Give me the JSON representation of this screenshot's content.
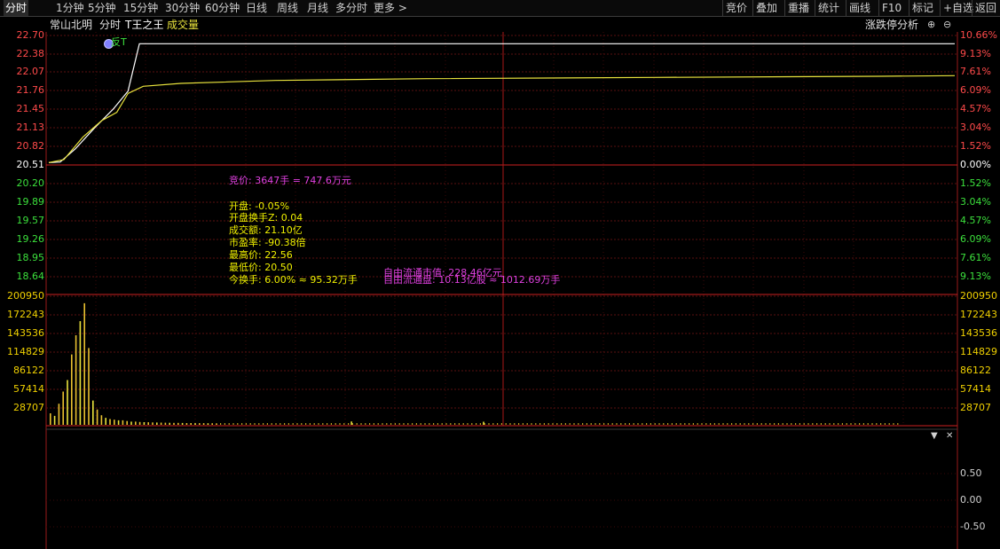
{
  "toolbar": {
    "left_tabs": [
      "分时",
      "1分钟",
      "5分钟",
      "15分钟",
      "30分钟",
      "60分钟",
      "日线",
      "周线",
      "月线",
      "多分时",
      "更多 >"
    ],
    "active_tab": 0,
    "right_buttons": [
      "竞价",
      "叠加",
      "重播",
      "统计",
      "画线",
      "F10",
      "标记",
      "+自选",
      "返回"
    ]
  },
  "header": {
    "stock_name": "常山北明",
    "mode": "分时",
    "indicator": "T王之王",
    "volume_label": "成交量",
    "analysis_button": "涨跌停分析"
  },
  "price_axis": {
    "left": [
      "22.70",
      "22.38",
      "22.07",
      "21.76",
      "21.45",
      "21.13",
      "20.82",
      "20.51",
      "20.20",
      "19.89",
      "19.57",
      "19.26",
      "18.95",
      "18.64"
    ],
    "right": [
      "10.66%",
      "9.13%",
      "7.61%",
      "6.09%",
      "4.57%",
      "3.04%",
      "1.52%",
      "0.00%",
      "1.52%",
      "3.04%",
      "4.57%",
      "6.09%",
      "7.61%",
      "9.13%"
    ]
  },
  "volume_axis": [
    "200950",
    "172243",
    "143536",
    "114829",
    "86122",
    "57414",
    "28707"
  ],
  "indicator_axis": [
    "0.50",
    "0.00",
    "-0.50"
  ],
  "marker": {
    "label": "反T"
  },
  "info": {
    "auction": "竞价: 3647手 = 747.6万元",
    "open": "开盘: -0.05%",
    "open_turnover": "开盘换手Z: 0.04",
    "amount": "成交额: 21.10亿",
    "pe": "市盈率: -90.38倍",
    "high": "最高价: 22.56",
    "low": "最低价: 20.50",
    "turnover": "今换手: 6.00% ≈ 95.32万手",
    "float_value": "自由流通市值: 228.46亿元",
    "float_shares": "自由流通盘: 10.13亿股 ≈ 1012.69万手"
  },
  "chart_data": {
    "type": "line",
    "title": "",
    "x_ticks": 240,
    "y_range": [
      18.48,
      22.85
    ],
    "prev_close": 20.51,
    "series": [
      {
        "name": "",
        "color": "#ffffff",
        "points": [
          [
            0,
            20.55
          ],
          [
            3,
            20.56
          ],
          [
            7,
            20.78
          ],
          [
            12,
            21.13
          ],
          [
            17,
            21.45
          ],
          [
            21,
            21.76
          ],
          [
            24,
            22.56
          ],
          [
            240,
            22.56
          ]
        ]
      },
      {
        "name": "",
        "color": "#e8e23c",
        "points": [
          [
            0,
            20.55
          ],
          [
            4,
            20.6
          ],
          [
            9,
            20.98
          ],
          [
            14,
            21.26
          ],
          [
            18,
            21.4
          ],
          [
            21,
            21.72
          ],
          [
            25,
            21.84
          ],
          [
            35,
            21.89
          ],
          [
            60,
            21.94
          ],
          [
            100,
            21.97
          ],
          [
            160,
            21.99
          ],
          [
            220,
            22.01
          ],
          [
            240,
            22.02
          ]
        ]
      }
    ],
    "volume": [
      18000,
      14000,
      33000,
      52000,
      70000,
      110000,
      140000,
      162000,
      190000,
      120000,
      38000,
      24000,
      15000,
      11000,
      9000,
      8000,
      7000,
      7000,
      6000,
      5000,
      5000,
      4500,
      4200,
      4000,
      3800,
      3600,
      3400,
      3300,
      3200,
      3100,
      3000,
      2900,
      2800,
      2800,
      2700,
      2600,
      2600,
      2500,
      2500,
      2400
    ],
    "volume_ylim": [
      0,
      215000
    ],
    "volume_spikes": [
      [
        80,
        5200
      ],
      [
        115,
        4800
      ]
    ]
  }
}
